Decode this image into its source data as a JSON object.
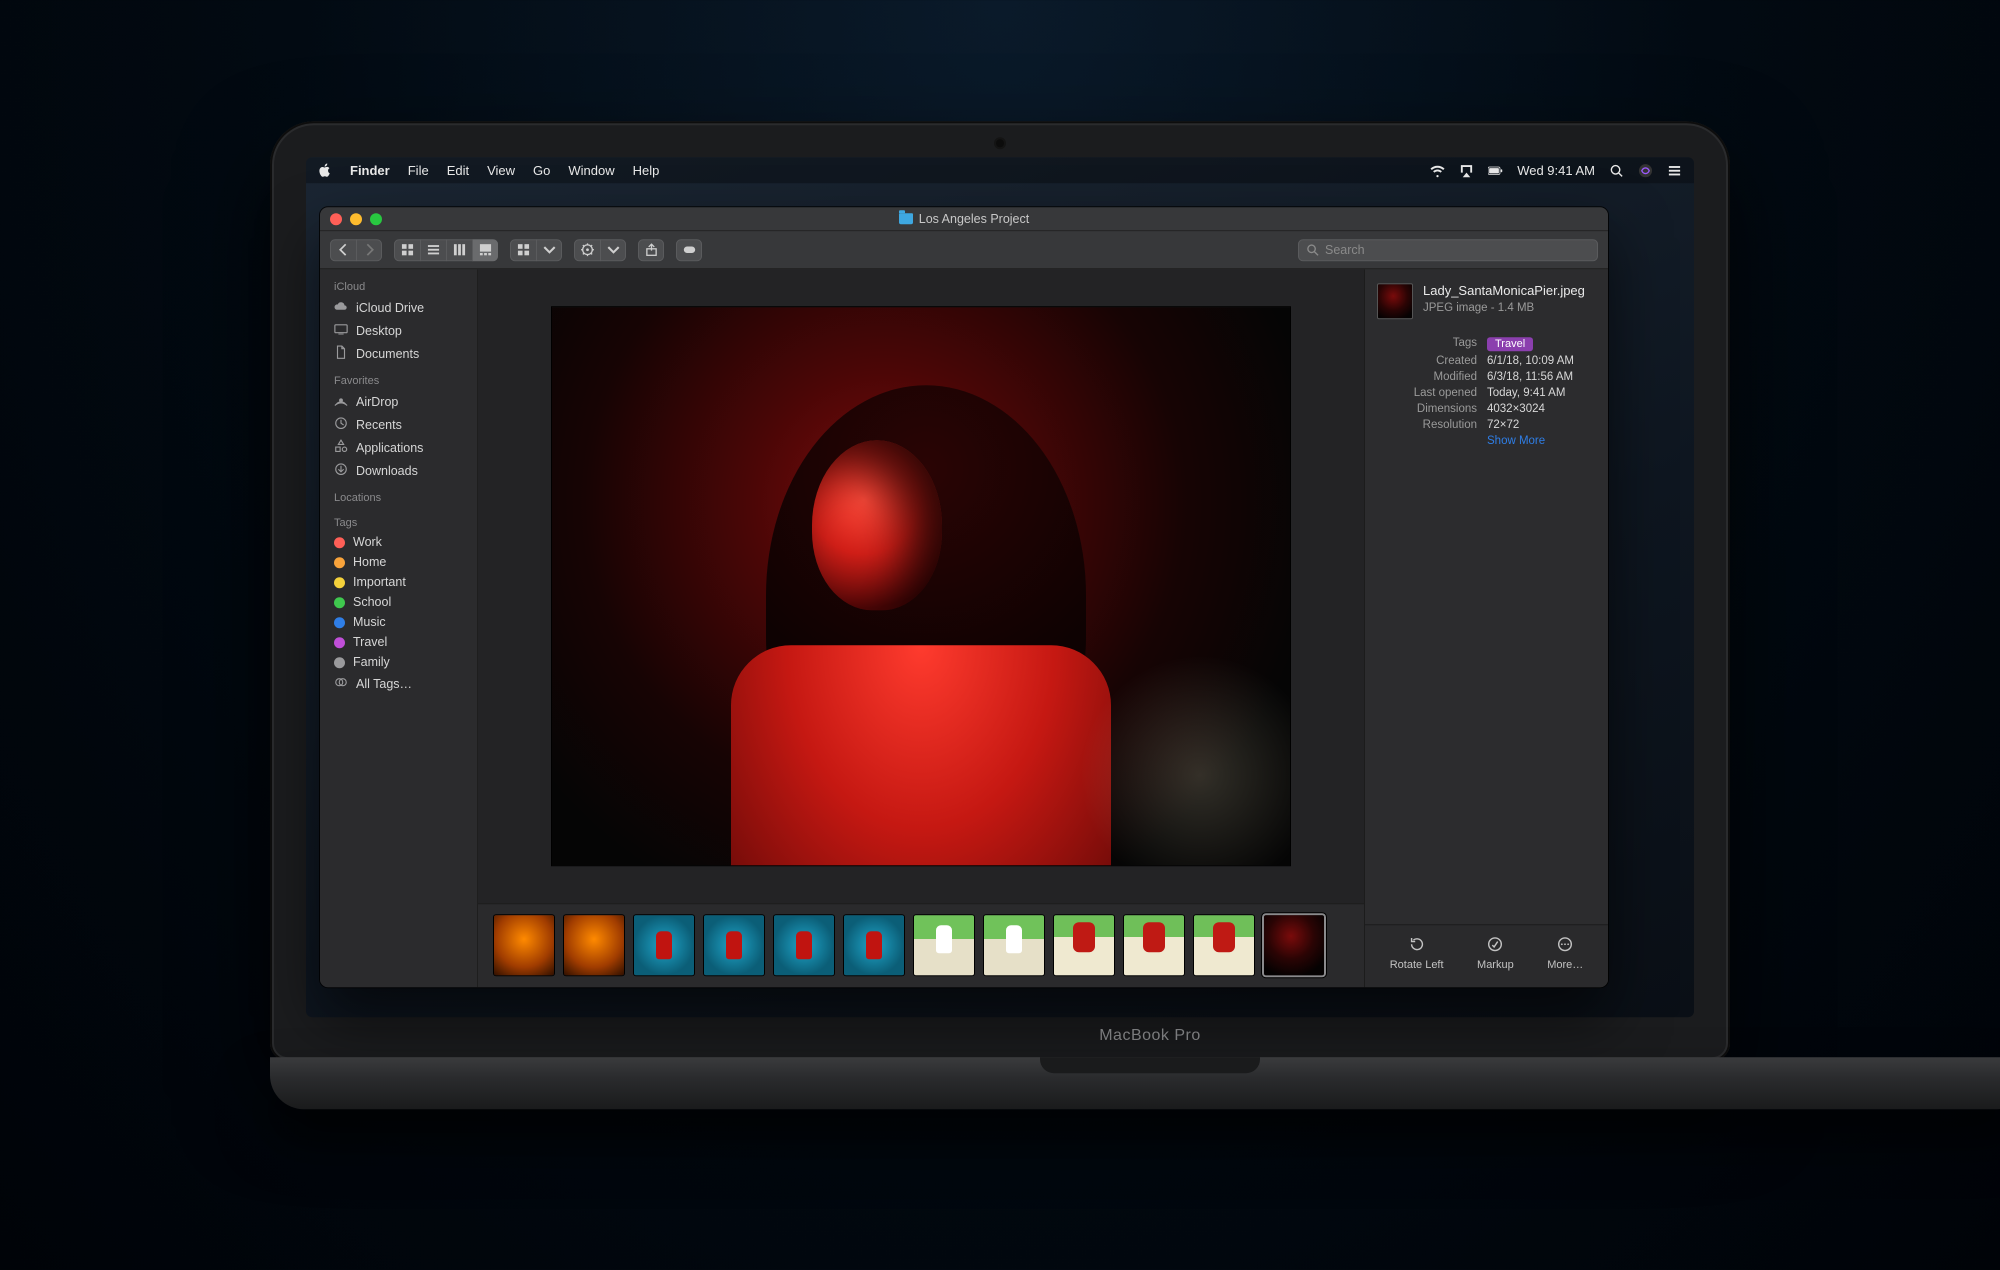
{
  "hardware": {
    "model_label": "MacBook Pro"
  },
  "menubar": {
    "app_name": "Finder",
    "items": [
      "File",
      "Edit",
      "View",
      "Go",
      "Window",
      "Help"
    ],
    "clock": "Wed 9:41 AM"
  },
  "window": {
    "title": "Los Angeles Project",
    "search_placeholder": "Search"
  },
  "sidebar": {
    "sections": [
      {
        "heading": "iCloud",
        "items": [
          {
            "label": "iCloud Drive",
            "icon": "cloud"
          },
          {
            "label": "Desktop",
            "icon": "desktop"
          },
          {
            "label": "Documents",
            "icon": "doc"
          }
        ]
      },
      {
        "heading": "Favorites",
        "items": [
          {
            "label": "AirDrop",
            "icon": "airdrop"
          },
          {
            "label": "Recents",
            "icon": "clock"
          },
          {
            "label": "Applications",
            "icon": "apps"
          },
          {
            "label": "Downloads",
            "icon": "download"
          }
        ]
      },
      {
        "heading": "Locations",
        "items": []
      },
      {
        "heading": "Tags",
        "items": [
          {
            "label": "Work",
            "color": "#fe5f57"
          },
          {
            "label": "Home",
            "color": "#f8a33b"
          },
          {
            "label": "Important",
            "color": "#f4d13b"
          },
          {
            "label": "School",
            "color": "#3fc84e"
          },
          {
            "label": "Music",
            "color": "#2f7ee6"
          },
          {
            "label": "Travel",
            "color": "#c04fd8"
          },
          {
            "label": "Family",
            "color": "#9a9a9c"
          },
          {
            "label": "All Tags…",
            "icon": "alltags"
          }
        ]
      }
    ]
  },
  "thumbnails": [
    {
      "style": "th-a",
      "selected": false
    },
    {
      "style": "th-a",
      "selected": false
    },
    {
      "style": "th-b",
      "selected": false
    },
    {
      "style": "th-b",
      "selected": false
    },
    {
      "style": "th-b",
      "selected": false
    },
    {
      "style": "th-b",
      "selected": false
    },
    {
      "style": "th-c",
      "selected": false
    },
    {
      "style": "th-c",
      "selected": false
    },
    {
      "style": "th-d",
      "selected": false
    },
    {
      "style": "th-d",
      "selected": false
    },
    {
      "style": "th-d",
      "selected": false
    },
    {
      "style": "th-e",
      "selected": true
    }
  ],
  "info": {
    "filename": "Lady_SantaMonicaPier.jpeg",
    "subtitle": "JPEG image - 1.4 MB",
    "rows": [
      {
        "label": "Tags",
        "value": "Travel",
        "pill": true
      },
      {
        "label": "Created",
        "value": "6/1/18, 10:09 AM"
      },
      {
        "label": "Modified",
        "value": "6/3/18, 11:56 AM"
      },
      {
        "label": "Last opened",
        "value": "Today, 9:41 AM"
      },
      {
        "label": "Dimensions",
        "value": "4032×3024"
      },
      {
        "label": "Resolution",
        "value": "72×72"
      }
    ],
    "show_more": "Show More"
  },
  "quick_actions": {
    "rotate": "Rotate Left",
    "markup": "Markup",
    "more": "More…"
  }
}
